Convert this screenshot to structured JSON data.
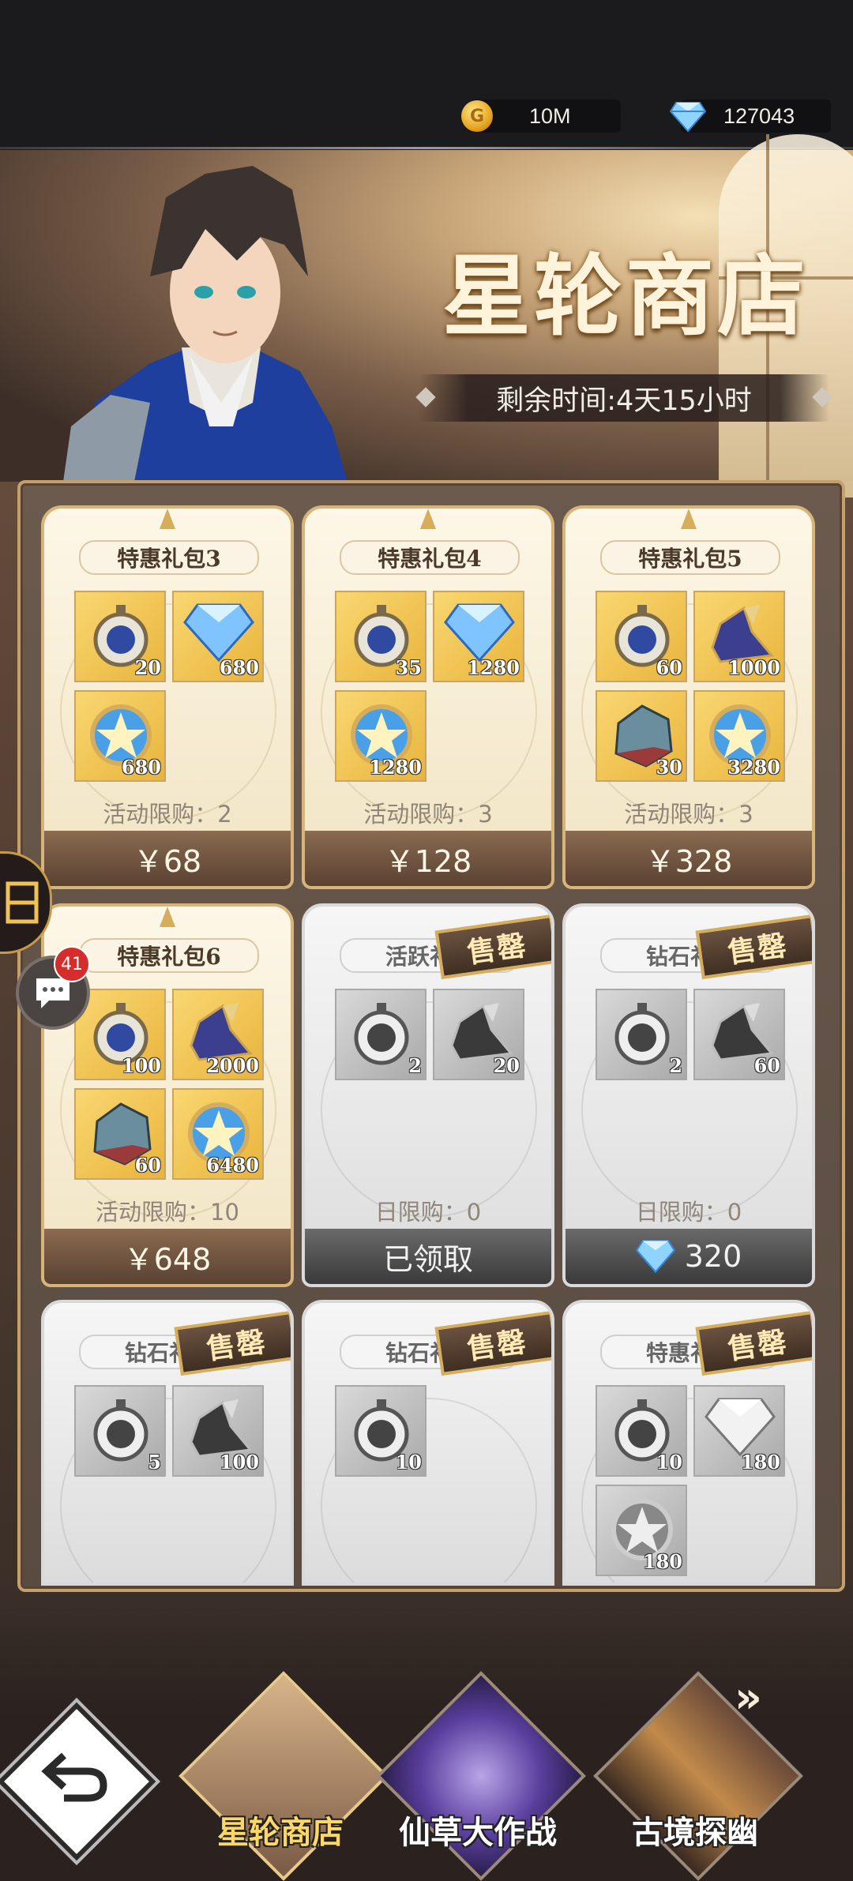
{
  "resources": {
    "gold": "10M",
    "diamonds": "127043"
  },
  "shop": {
    "title": "星轮商店",
    "timer": "剩余时间:4天15小时"
  },
  "cards": [
    {
      "name": "特惠礼包3",
      "style": "gold",
      "items": [
        {
          "icon": "pocket-watch-icon",
          "qty": "20"
        },
        {
          "icon": "diamond-icon",
          "qty": "680"
        },
        {
          "icon": "star-medal-icon",
          "qty": "680"
        }
      ],
      "limit": "活动限购：2",
      "price": "￥68"
    },
    {
      "name": "特惠礼包4",
      "style": "gold",
      "items": [
        {
          "icon": "pocket-watch-icon",
          "qty": "35"
        },
        {
          "icon": "diamond-icon",
          "qty": "1280"
        },
        {
          "icon": "star-medal-icon",
          "qty": "1280"
        }
      ],
      "limit": "活动限购：3",
      "price": "￥128"
    },
    {
      "name": "特惠礼包5",
      "style": "gold",
      "items": [
        {
          "icon": "pocket-watch-icon",
          "qty": "60"
        },
        {
          "icon": "winged-boot-icon",
          "qty": "1000"
        },
        {
          "icon": "crystal-ore-icon",
          "qty": "30"
        },
        {
          "icon": "star-medal-icon",
          "qty": "3280"
        }
      ],
      "limit": "活动限购：3",
      "price": "￥328"
    },
    {
      "name": "特惠礼包6",
      "style": "gold",
      "items": [
        {
          "icon": "pocket-watch-icon",
          "qty": "100"
        },
        {
          "icon": "winged-boot-icon",
          "qty": "2000"
        },
        {
          "icon": "crystal-ore-icon",
          "qty": "60"
        },
        {
          "icon": "star-medal-icon",
          "qty": "6480"
        }
      ],
      "limit": "活动限购：10",
      "price": "￥648"
    },
    {
      "name": "活跃礼包",
      "style": "grey",
      "soldout": "售罄",
      "items": [
        {
          "icon": "pocket-watch-icon",
          "qty": "2"
        },
        {
          "icon": "winged-boot-icon",
          "qty": "20"
        }
      ],
      "limit": "日限购：0",
      "price": "已领取"
    },
    {
      "name": "钻石礼包",
      "style": "grey",
      "soldout": "售罄",
      "items": [
        {
          "icon": "pocket-watch-icon",
          "qty": "2"
        },
        {
          "icon": "winged-boot-icon",
          "qty": "60"
        }
      ],
      "limit": "日限购：0",
      "price": "320",
      "price_icon": "diamond-icon"
    },
    {
      "name": "钻石礼包",
      "style": "grey",
      "soldout": "售罄",
      "items": [
        {
          "icon": "pocket-watch-icon",
          "qty": "5"
        },
        {
          "icon": "winged-boot-icon",
          "qty": "100"
        }
      ]
    },
    {
      "name": "钻石礼包",
      "style": "grey",
      "soldout": "售罄",
      "items": [
        {
          "icon": "pocket-watch-icon",
          "qty": "10"
        }
      ]
    },
    {
      "name": "特惠礼包",
      "style": "grey",
      "soldout": "售罄",
      "items": [
        {
          "icon": "pocket-watch-icon",
          "qty": "10"
        },
        {
          "icon": "diamond-icon",
          "qty": "180"
        },
        {
          "icon": "star-medal-icon",
          "qty": "180"
        }
      ]
    }
  ],
  "side": {
    "chat_badge": "41"
  },
  "nav": {
    "tabs": [
      {
        "label": "星轮商店",
        "active": true
      },
      {
        "label": "仙草大作战",
        "active": false
      },
      {
        "label": "古境探幽",
        "active": false
      }
    ]
  }
}
